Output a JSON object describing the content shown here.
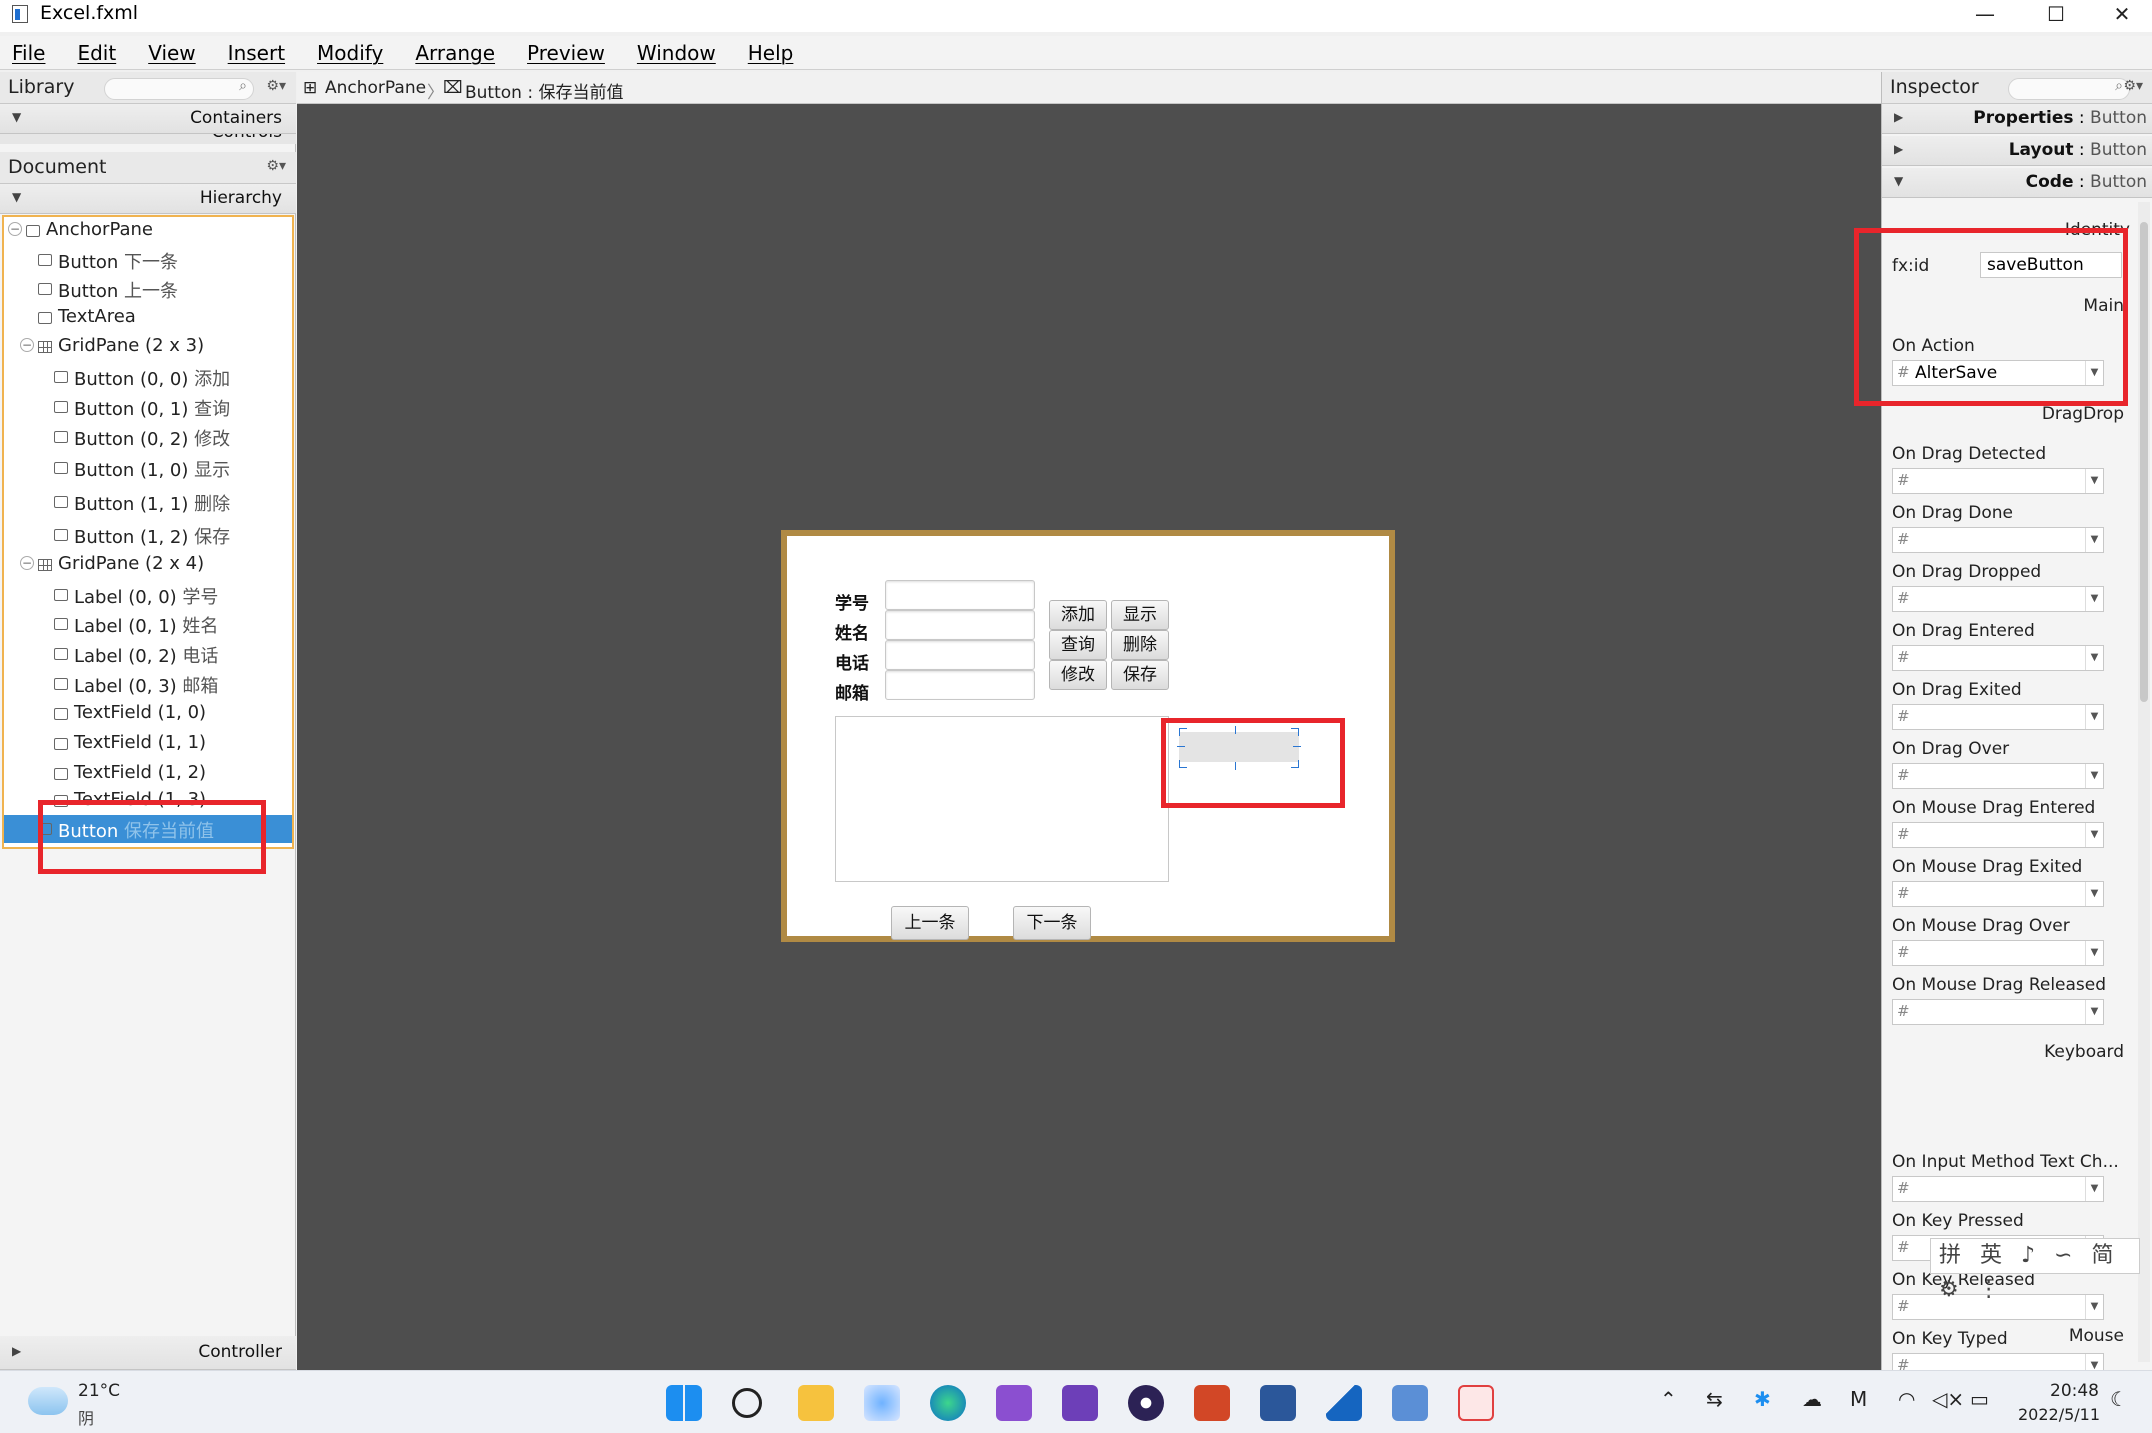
{
  "window": {
    "title": "Excel.fxml",
    "minimize": "—",
    "maximize": "☐",
    "close": "✕"
  },
  "menu": [
    "File",
    "Edit",
    "View",
    "Insert",
    "Modify",
    "Arrange",
    "Preview",
    "Window",
    "Help"
  ],
  "library": {
    "title": "Library",
    "section": "Containers",
    "cut_text": "Controls"
  },
  "document": {
    "title": "Document",
    "section": "Hierarchy",
    "controller": "Controller"
  },
  "tree": [
    {
      "label": "AnchorPane",
      "cn": "",
      "icon": "anchor",
      "toggle": "−",
      "indent": 0
    },
    {
      "label": "Button",
      "cn": "下一条",
      "icon": "button",
      "indent": 1
    },
    {
      "label": "Button",
      "cn": "上一条",
      "icon": "button",
      "indent": 1
    },
    {
      "label": "TextArea",
      "cn": "",
      "icon": "textarea",
      "indent": 1
    },
    {
      "label": "GridPane (2 x 3)",
      "cn": "",
      "icon": "grid",
      "toggle": "−",
      "indent": 1
    },
    {
      "label": "Button (0, 0)",
      "cn": "添加",
      "icon": "button",
      "indent": 2
    },
    {
      "label": "Button (0, 1)",
      "cn": "查询",
      "icon": "button",
      "indent": 2
    },
    {
      "label": "Button (0, 2)",
      "cn": "修改",
      "icon": "button",
      "indent": 2
    },
    {
      "label": "Button (1, 0)",
      "cn": "显示",
      "icon": "button",
      "indent": 2
    },
    {
      "label": "Button (1, 1)",
      "cn": "删除",
      "icon": "button",
      "indent": 2
    },
    {
      "label": "Button (1, 2)",
      "cn": "保存",
      "icon": "button",
      "indent": 2
    },
    {
      "label": "GridPane (2 x 4)",
      "cn": "",
      "icon": "grid",
      "toggle": "−",
      "indent": 1
    },
    {
      "label": "Label (0, 0)",
      "cn": "学号",
      "icon": "label",
      "indent": 2
    },
    {
      "label": "Label (0, 1)",
      "cn": "姓名",
      "icon": "label",
      "indent": 2
    },
    {
      "label": "Label (0, 2)",
      "cn": "电话",
      "icon": "label",
      "indent": 2
    },
    {
      "label": "Label (0, 3)",
      "cn": "邮箱",
      "icon": "label",
      "indent": 2
    },
    {
      "label": "TextField (1, 0)",
      "cn": "",
      "icon": "textfield",
      "indent": 2
    },
    {
      "label": "TextField (1, 1)",
      "cn": "",
      "icon": "textfield",
      "indent": 2
    },
    {
      "label": "TextField (1, 2)",
      "cn": "",
      "icon": "textfield",
      "indent": 2
    },
    {
      "label": "TextField (1, 3)",
      "cn": "",
      "icon": "textfield",
      "indent": 2
    },
    {
      "label": "Button",
      "cn": "保存当前值",
      "icon": "button",
      "indent": 1,
      "selected": true
    }
  ],
  "breadcrumb": {
    "root": "AnchorPane",
    "sep": "〉",
    "current": "Button : 保存当前值"
  },
  "form": {
    "labels": [
      "学号",
      "姓名",
      "电话",
      "邮箱"
    ],
    "buttons": {
      "add": "添加",
      "show": "显示",
      "query": "查询",
      "delete": "删除",
      "modify": "修改",
      "save": "保存"
    },
    "prev": "上一条",
    "next": "下一条"
  },
  "inspector": {
    "title": "Inspector",
    "sections": [
      {
        "name": "Properties",
        "sub": "Button",
        "arrow": "▶"
      },
      {
        "name": "Layout",
        "sub": "Button",
        "arrow": "▶"
      },
      {
        "name": "Code",
        "sub": "Button",
        "arrow": "▼"
      }
    ],
    "identity": "Identity",
    "fxid_label": "fx:id",
    "fxid_value": "saveButton",
    "main": "Main",
    "on_action_label": "On Action",
    "on_action_value": "AlterSave",
    "dragdrop": "DragDrop",
    "drag_events": [
      "On Drag Detected",
      "On Drag Done",
      "On Drag Dropped",
      "On Drag Entered",
      "On Drag Exited",
      "On Drag Over",
      "On Mouse Drag Entered",
      "On Mouse Drag Exited",
      "On Mouse Drag Over",
      "On Mouse Drag Released"
    ],
    "keyboard": "Keyboard",
    "key_events": [
      "On Input Method Text Ch...",
      "On Key Pressed",
      "On Key Released",
      "On Key Typed"
    ],
    "mouse": "Mouse"
  },
  "ime": "拼 英 ♪ ∽ 简 ⚙ ⋮",
  "taskbar": {
    "weather_temp": "21°C",
    "weather_desc": "阴",
    "time": "20:48",
    "date": "2022/5/11"
  },
  "colors": {
    "accent": "#3a8fd6",
    "highlight": "#e8252b",
    "canvas_border": "#b08a44",
    "editor_bg": "#4e4e4e"
  }
}
